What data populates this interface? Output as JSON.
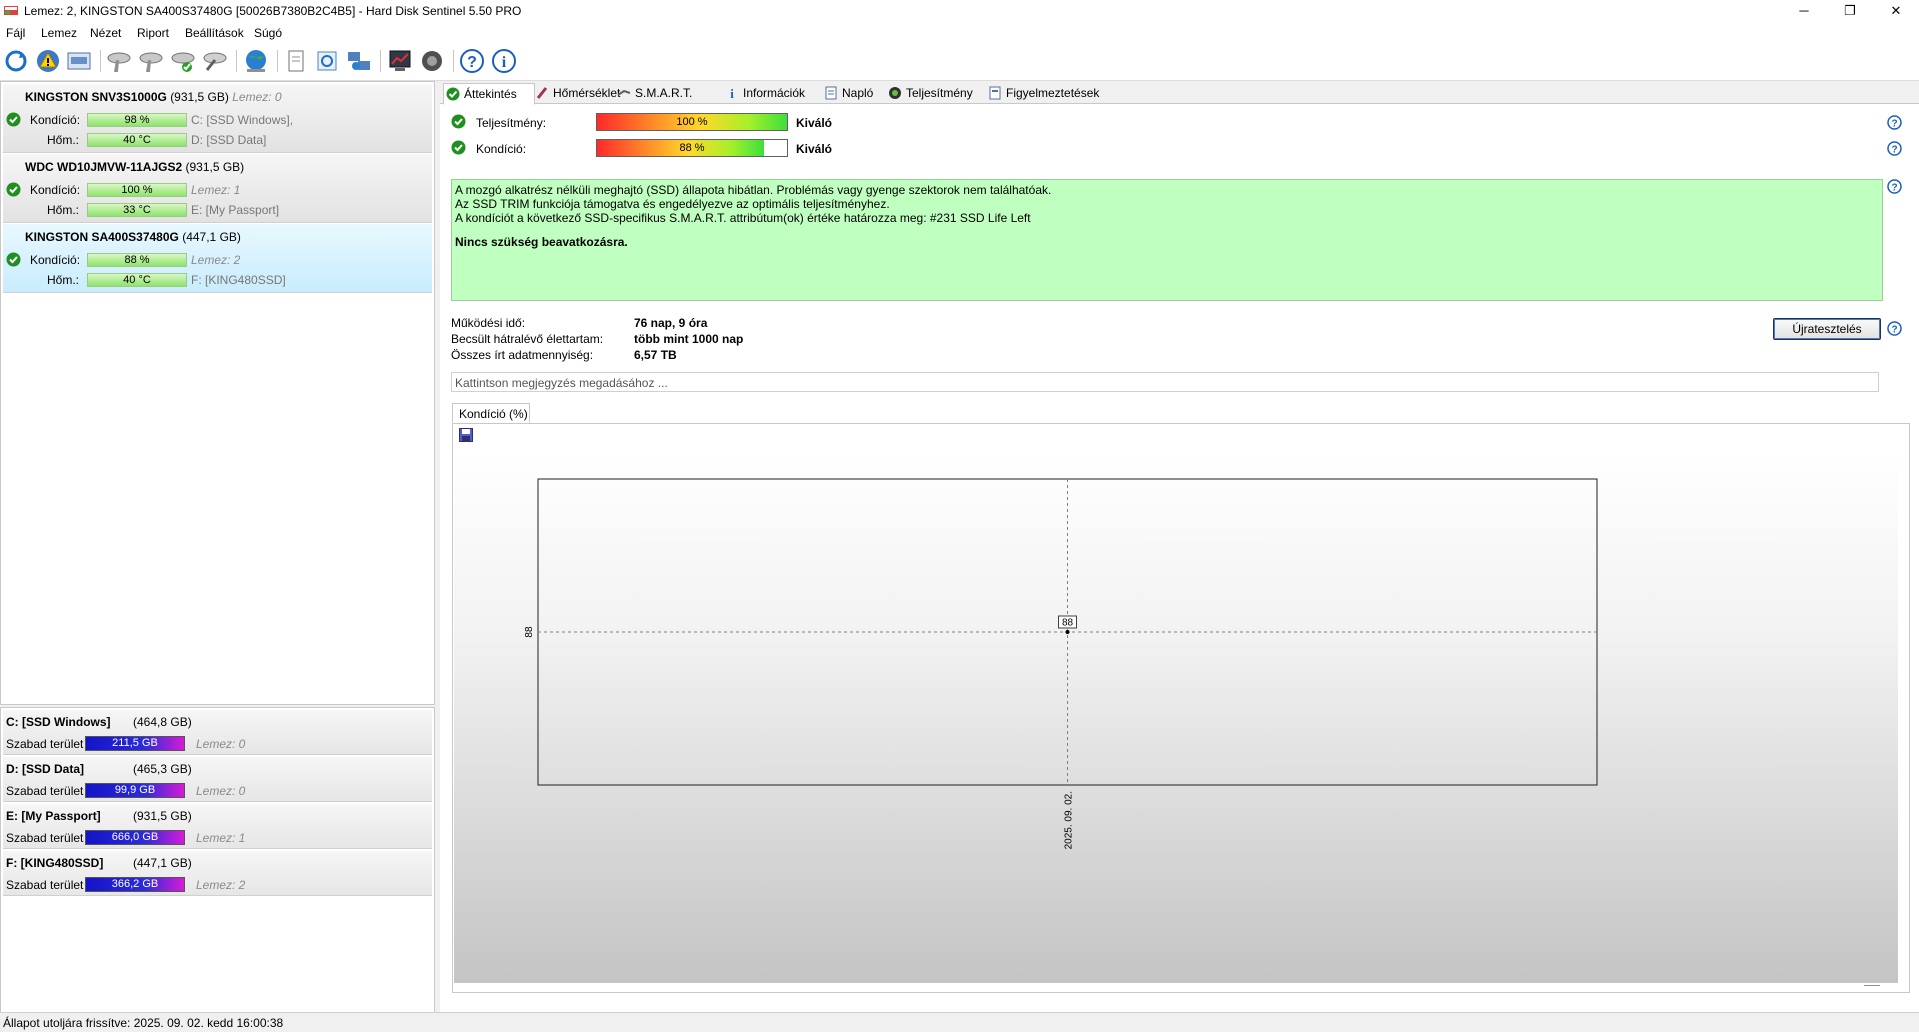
{
  "window": {
    "title": "Lemez: 2, KINGSTON SA400S37480G [50026B7380B2C4B5]  -  Hard Disk Sentinel 5.50 PRO",
    "controls": [
      "─",
      "❐",
      "✕"
    ]
  },
  "menu": [
    "Fájl",
    "Lemez",
    "Nézet",
    "Riport",
    "Beállítások",
    "Súgó"
  ],
  "toolbar": {
    "icons": [
      "refresh-icon",
      "alert-icon",
      "report-icon",
      "disk-wrench-icon",
      "disk-test-icon",
      "disk-check-icon",
      "disk-tool-icon",
      "globe-icon",
      "document-icon",
      "sync-icon",
      "network-icon",
      "monitor-icon",
      "sound-icon",
      "help-icon",
      "info-icon"
    ]
  },
  "disks": [
    {
      "name": "KINGSTON SNV3S1000G",
      "size": "(931,5 GB)",
      "lemez": "Lemez: 0",
      "cond_label": "Kondíció:",
      "cond": "98 %",
      "temp_label": "Hőm.:",
      "temp": "40 °C",
      "vol1": "C: [SSD Windows],",
      "vol2": "D: [SSD Data]"
    },
    {
      "name": "WDC WD10JMVW-11AJGS2",
      "size": "(931,5 GB)",
      "lemez": "",
      "cond_label": "Kondíció:",
      "cond": "100 %",
      "temp_label": "Hőm.:",
      "temp": "33 °C",
      "vol1": "Lemez: 1",
      "vol2": "E: [My Passport]"
    },
    {
      "name": "KINGSTON SA400S37480G",
      "size": "(447,1 GB)",
      "lemez": "",
      "cond_label": "Kondíció:",
      "cond": "88 %",
      "temp_label": "Hőm.:",
      "temp": "40 °C",
      "vol1": "Lemez: 2",
      "vol2": "F: [KING480SSD]"
    }
  ],
  "volumes": [
    {
      "name": "C: [SSD Windows]",
      "size": "(464,8 GB)",
      "free_label": "Szabad terület",
      "free": "211,5 GB",
      "disk": "Lemez: 0"
    },
    {
      "name": "D: [SSD Data]",
      "size": "(465,3 GB)",
      "free_label": "Szabad terület",
      "free": "99,9 GB",
      "disk": "Lemez: 0"
    },
    {
      "name": "E: [My Passport]",
      "size": "(931,5 GB)",
      "free_label": "Szabad terület",
      "free": "666,0 GB",
      "disk": "Lemez: 1"
    },
    {
      "name": "F: [KING480SSD]",
      "size": "(447,1 GB)",
      "free_label": "Szabad terület",
      "free": "366,2 GB",
      "disk": "Lemez: 2"
    }
  ],
  "tabs": [
    "Áttekintés",
    "Hőmérséklet",
    "S.M.A.R.T.",
    "Információk",
    "Napló",
    "Teljesítmény",
    "Figyelmeztetések"
  ],
  "overview": {
    "perf_label": "Teljesítmény:",
    "perf_value": "100 %",
    "perf_fraction": 1.0,
    "perf_rating": "Kiváló",
    "health_label": "Kondíció:",
    "health_value": "88 %",
    "health_fraction": 0.88,
    "health_rating": "Kiváló",
    "status_lines": [
      "A mozgó alkatrész nélküli meghajtó (SSD) állapota hibátlan. Problémás vagy gyenge szektorok nem találhatóak.",
      "Az SSD TRIM funkciója támogatva és engedélyezve az optimális teljesítményhez.",
      "A kondíciót a következő SSD-specifikus S.M.A.R.T. attribútum(ok) értéke határozza meg:  #231 SSD Life Left"
    ],
    "status_action": "Nincs szükség beavatkozásra.",
    "uptime_label": "Működési idő:",
    "uptime_value": "76 nap, 9 óra",
    "lifetime_label": "Becsült hátralévő élettartam:",
    "lifetime_value": "több mint 1000 nap",
    "written_label": "Összes írt adatmennyiség:",
    "written_value": "6,57 TB",
    "retest_button": "Újratesztelés",
    "note_placeholder": "Kattintson megjegyzés megadásához ..."
  },
  "chart_tab": "Kondíció  (%)",
  "chart_data": {
    "type": "line",
    "title": "",
    "xlabel": "",
    "ylabel": "",
    "x": [
      "2025. 09. 02."
    ],
    "series": [
      {
        "values": [
          88
        ]
      }
    ],
    "y_tick_labels": [
      "88"
    ],
    "x_tick_labels": [
      "2025. 09. 02."
    ],
    "data_labels": [
      "88"
    ],
    "grid": "dashed crosshair at data point"
  },
  "statusbar": {
    "text": "Állapot utoljára frissítve: 2025. 09. 02. kedd 16:00:38"
  },
  "colors": {
    "status_ok": "#bfffbf",
    "health_gradient_end": "#3ce03c",
    "volume_bar_start": "#1414c8",
    "volume_bar_end": "#d81ad8",
    "selected_row": "#c9ecfc"
  }
}
